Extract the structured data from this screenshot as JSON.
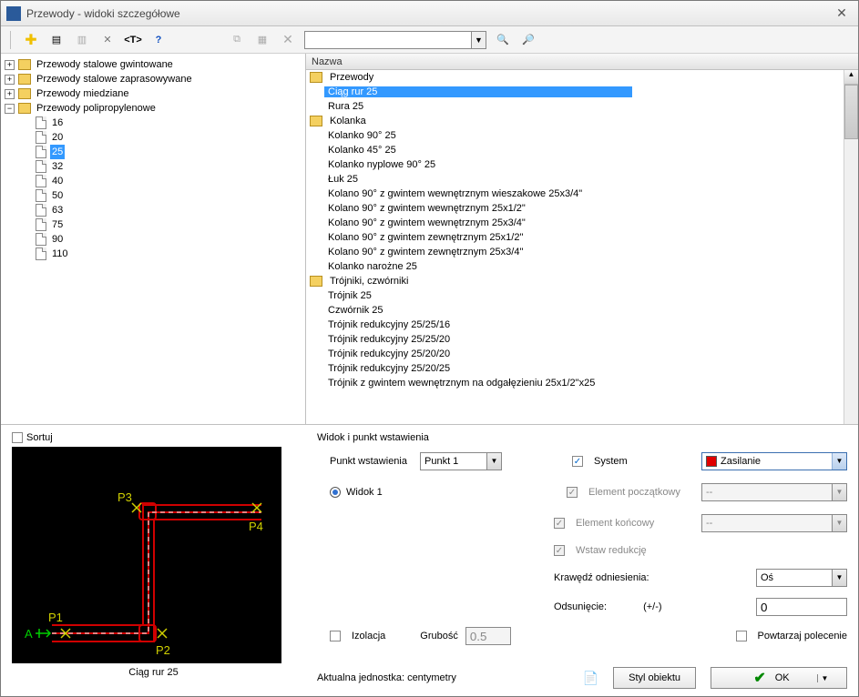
{
  "window": {
    "title": "Przewody - widoki szczegółowe"
  },
  "tree": {
    "roots": [
      {
        "label": "Przewody stalowe gwintowane",
        "expanded": false
      },
      {
        "label": "Przewody stalowe zaprasowywane",
        "expanded": false
      },
      {
        "label": "Przewody miedziane",
        "expanded": false
      },
      {
        "label": "Przewody polipropylenowe",
        "expanded": true,
        "children": [
          "16",
          "20",
          "25",
          "32",
          "40",
          "50",
          "63",
          "75",
          "90",
          "110"
        ],
        "selected": "25"
      }
    ]
  },
  "list": {
    "header": "Nazwa",
    "groups": [
      {
        "label": "Przewody",
        "items": [
          "Ciąg rur 25",
          "Rura 25"
        ],
        "selected": "Ciąg rur 25"
      },
      {
        "label": "Kolanka",
        "items": [
          "Kolanko 90° 25",
          "Kolanko 45° 25",
          "Kolanko nyplowe 90° 25",
          "Łuk 25",
          "Kolano 90° z gwintem wewnętrznym wieszakowe 25x3/4\"",
          "Kolano 90° z gwintem wewnętrznym 25x1/2\"",
          "Kolano 90° z gwintem wewnętrznym 25x3/4\"",
          "Kolano 90° z gwintem zewnętrznym 25x1/2\"",
          "Kolano 90° z gwintem zewnętrznym 25x3/4\"",
          "Kolanko narożne 25"
        ]
      },
      {
        "label": "Trójniki, czwórniki",
        "items": [
          "Trójnik 25",
          "Czwórnik 25",
          "Trójnik redukcyjny 25/25/16",
          "Trójnik redukcyjny 25/25/20",
          "Trójnik redukcyjny 25/20/20",
          "Trójnik redukcyjny 25/20/25",
          "Trójnik z gwintem wewnętrznym na odgałęzieniu 25x1/2\"x25"
        ]
      }
    ]
  },
  "sortuj_label": "Sortuj",
  "preview_caption": "Ciąg rur 25",
  "preview_labels": {
    "p1": "P1",
    "p2": "P2",
    "p3": "P3",
    "p4": "P4",
    "a": "A"
  },
  "props": {
    "section_title": "Widok i punkt wstawienia",
    "punkt_label": "Punkt wstawienia",
    "punkt_value": "Punkt 1",
    "widok_label": "Widok 1",
    "system_label": "System",
    "system_value": "Zasilanie",
    "elem_pocz_label": "Element początkowy",
    "elem_pocz_value": "--",
    "elem_kon_label": "Element końcowy",
    "elem_kon_value": "--",
    "wstaw_red_label": "Wstaw redukcję",
    "krawedz_label": "Krawędź odniesienia:",
    "krawedz_value": "Oś",
    "odsun_label": "Odsunięcie:",
    "odsun_pm": "(+/-)",
    "odsun_value": "0",
    "izolacja_label": "Izolacja",
    "grubosc_label": "Grubość",
    "grubosc_value": "0.5",
    "powtarzaj_label": "Powtarzaj polecenie",
    "jednostka_label": "Aktualna jednostka: centymetry",
    "styl_label": "Styl obiektu",
    "ok_label": "OK"
  }
}
